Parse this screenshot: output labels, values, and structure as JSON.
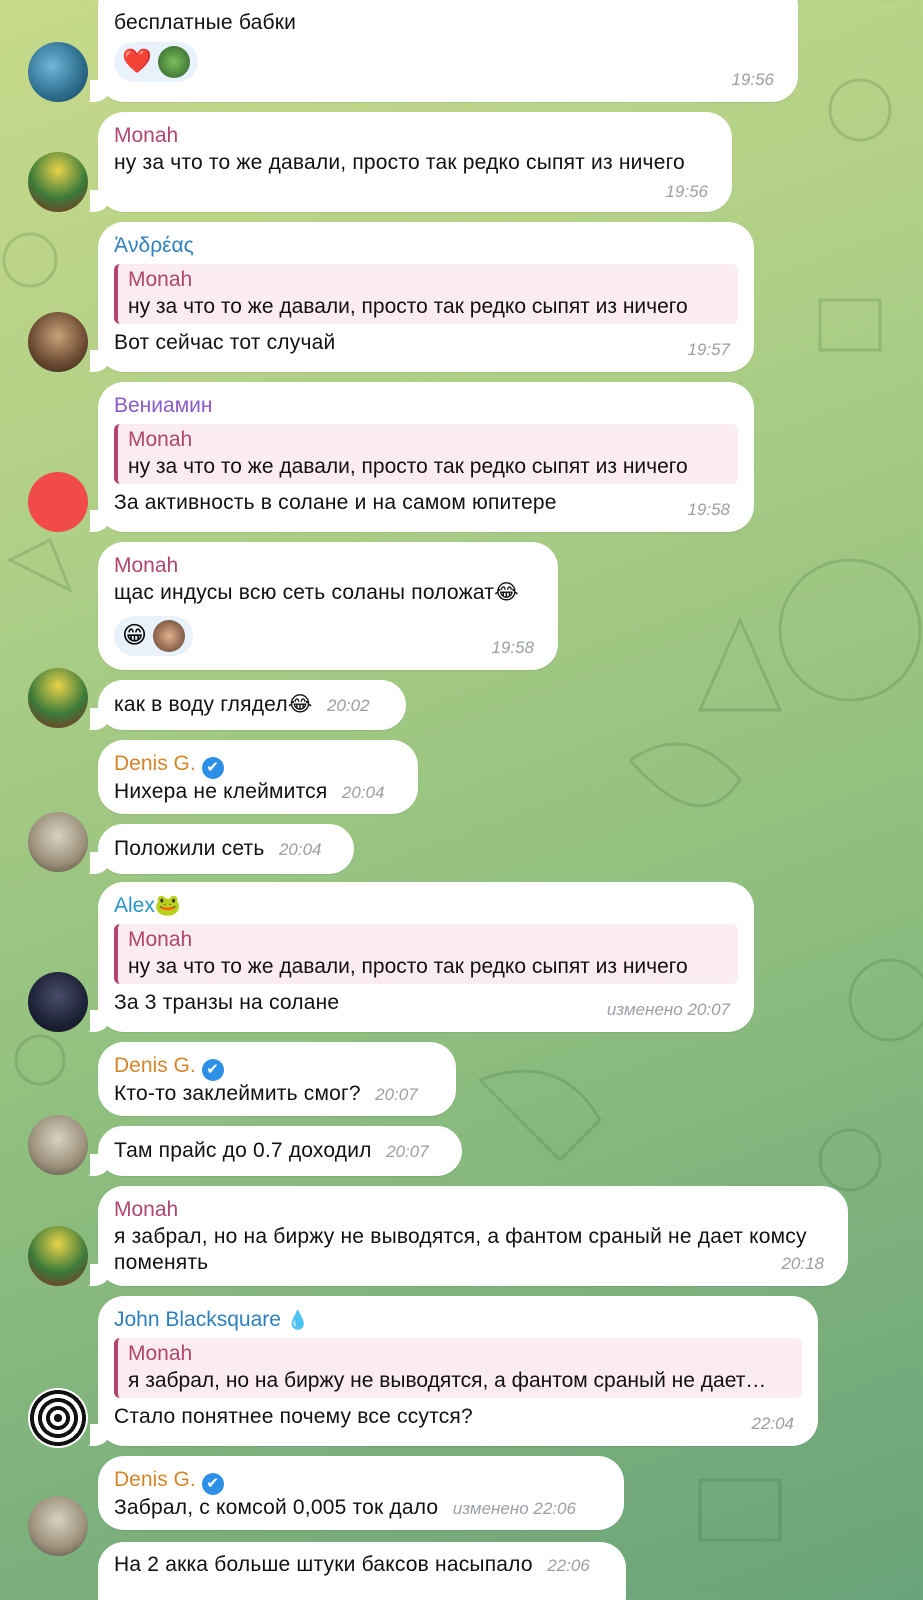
{
  "colors": {
    "monah": "#b0466e",
    "andreas": "#2e7fbf",
    "veniamin": "#8a5ac8",
    "denis": "#d6862a",
    "alex": "#2a95c8",
    "john": "#2e7fbf",
    "verified": "#2e8fe6",
    "reply_bar": "#b0466e"
  },
  "messages": [
    {
      "id": "m1",
      "text": "бесплатные бабки",
      "time": "19:56",
      "reactions": [
        "❤️",
        "avatar"
      ]
    },
    {
      "id": "m2",
      "sender": "Monah",
      "text": "ну за что то же давали, просто так редко сыпят из ничего",
      "time": "19:56"
    },
    {
      "id": "m3",
      "sender": "Ἀνδρέας",
      "reply_name": "Monah",
      "reply_text": "ну за что то же давали, просто так редко сыпят из ничего",
      "text": "Вот сейчас тот случай",
      "time": "19:57"
    },
    {
      "id": "m4",
      "sender": "Вениамин",
      "reply_name": "Monah",
      "reply_text": "ну за что то же давали, просто так редко сыпят из ничего",
      "text": "За активность в солане и на самом юпитере",
      "time": "19:58"
    },
    {
      "id": "m5",
      "sender": "Monah",
      "text": "щас индусы всю сеть соланы положат😂",
      "time": "19:58",
      "reactions": [
        "😁",
        "avatar"
      ]
    },
    {
      "id": "m6",
      "text": "как в воду глядел😂",
      "time": "20:02"
    },
    {
      "id": "m7",
      "sender": "Denis G.",
      "text": "Нихера не клеймится",
      "time": "20:04"
    },
    {
      "id": "m8",
      "text": "Положили сеть",
      "time": "20:04"
    },
    {
      "id": "m9",
      "sender": "Alex🐸",
      "reply_name": "Monah",
      "reply_text": "ну за что то же давали, просто так редко сыпят из ничего",
      "text": "За 3 транзы на солане",
      "time": "изменено 20:07"
    },
    {
      "id": "m10",
      "sender": "Denis G.",
      "text": "Кто-то заклеймить смог?",
      "time": "20:07"
    },
    {
      "id": "m11",
      "text": "Там прайс до 0.7 доходил",
      "time": "20:07"
    },
    {
      "id": "m12",
      "sender": "Monah",
      "text_line1": "я забрал, но на биржу не выводятся, а фантом сраный не дает комсу",
      "text_line2": "поменять",
      "time": "20:18"
    },
    {
      "id": "m13",
      "sender": "John Blacksquare",
      "sender_emoji": "💧",
      "reply_name": "Monah",
      "reply_text": "я забрал, но на биржу не выводятся, а фантом сраный не дает…",
      "text": "Стало понятнее почему все ссутся?",
      "time": "22:04"
    },
    {
      "id": "m14",
      "sender": "Denis G.",
      "text": "Забрал, с комсой 0,005 ток дало",
      "time": "изменено 22:06"
    },
    {
      "id": "m15",
      "text": "На 2 акка больше штуки баксов насыпало",
      "time": "22:06"
    }
  ],
  "icons": {
    "verified": "✔"
  }
}
